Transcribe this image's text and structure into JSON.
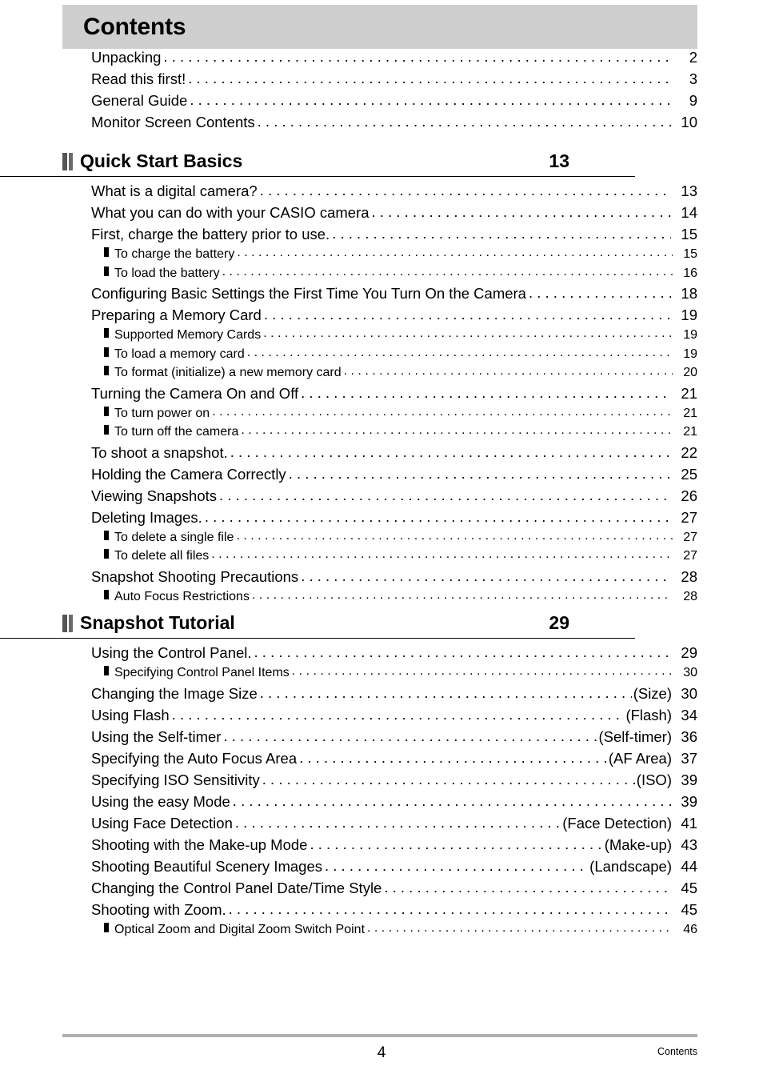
{
  "header": {
    "title": "Contents"
  },
  "footer": {
    "page_number": "4",
    "label": "Contents"
  },
  "icons": {
    "section_marker": "double-bar-icon",
    "sub_entry_marker": "square-bullet-icon"
  },
  "colors": {
    "title_band": "#cfcfcf",
    "section_bar_dark": "#555555",
    "section_bar_light": "#6b6b6b",
    "footer_rule": "#b0b0b0",
    "text": "#000000"
  },
  "intro_entries": [
    {
      "title": "Unpacking",
      "page": "2"
    },
    {
      "title": "Read this first!",
      "page": "3"
    },
    {
      "title": "General Guide",
      "page": "9"
    },
    {
      "title": "Monitor Screen Contents",
      "page": "10"
    }
  ],
  "sections": [
    {
      "title": "Quick Start Basics",
      "page": "13",
      "entries": [
        {
          "level": 1,
          "title": "What is a digital camera?",
          "suffix": "",
          "page": "13"
        },
        {
          "level": 1,
          "title": "What you can do with your CASIO camera",
          "suffix": "",
          "page": "14"
        },
        {
          "level": 1,
          "title": "First, charge the battery prior to use.",
          "suffix": "",
          "page": "15"
        },
        {
          "level": 2,
          "title": "To charge the battery",
          "suffix": "",
          "page": "15"
        },
        {
          "level": 2,
          "title": "To load the battery",
          "suffix": "",
          "page": "16"
        },
        {
          "level": 1,
          "title": "Configuring Basic Settings the First Time You Turn On the Camera",
          "suffix": "",
          "page": "18"
        },
        {
          "level": 1,
          "title": "Preparing a Memory Card",
          "suffix": "",
          "page": "19"
        },
        {
          "level": 2,
          "title": "Supported Memory Cards",
          "suffix": "",
          "page": "19"
        },
        {
          "level": 2,
          "title": "To load a memory card",
          "suffix": "",
          "page": "19"
        },
        {
          "level": 2,
          "title": "To format (initialize) a new memory card",
          "suffix": "",
          "page": "20"
        },
        {
          "level": 1,
          "title": "Turning the Camera On and Off",
          "suffix": "",
          "page": "21"
        },
        {
          "level": 2,
          "title": "To turn power on",
          "suffix": "",
          "page": "21"
        },
        {
          "level": 2,
          "title": "To turn off the camera",
          "suffix": "",
          "page": "21"
        },
        {
          "level": 1,
          "title": "To shoot a snapshot.",
          "suffix": "",
          "page": "22"
        },
        {
          "level": 1,
          "title": "Holding the Camera Correctly",
          "suffix": "",
          "page": "25"
        },
        {
          "level": 1,
          "title": "Viewing Snapshots",
          "suffix": "",
          "page": "26"
        },
        {
          "level": 1,
          "title": "Deleting Images.",
          "suffix": "",
          "page": "27"
        },
        {
          "level": 2,
          "title": "To delete a single file",
          "suffix": "",
          "page": "27"
        },
        {
          "level": 2,
          "title": "To delete all files",
          "suffix": "",
          "page": "27"
        },
        {
          "level": 1,
          "title": "Snapshot Shooting Precautions",
          "suffix": "",
          "page": "28"
        },
        {
          "level": 2,
          "title": "Auto Focus Restrictions",
          "suffix": "",
          "page": "28"
        }
      ]
    },
    {
      "title": "Snapshot Tutorial",
      "page": "29",
      "entries": [
        {
          "level": 1,
          "title": "Using the Control Panel.",
          "suffix": "",
          "page": "29"
        },
        {
          "level": 2,
          "title": "Specifying Control Panel Items",
          "suffix": "",
          "page": "30"
        },
        {
          "level": 1,
          "title": "Changing the Image Size",
          "suffix": "(Size)",
          "page": "30"
        },
        {
          "level": 1,
          "title": "Using Flash",
          "suffix": "(Flash)",
          "page": "34"
        },
        {
          "level": 1,
          "title": "Using the Self-timer",
          "suffix": "(Self-timer)",
          "page": "36"
        },
        {
          "level": 1,
          "title": "Specifying the Auto Focus Area",
          "suffix": "(AF Area)",
          "page": "37"
        },
        {
          "level": 1,
          "title": "Specifying ISO Sensitivity",
          "suffix": "(ISO)",
          "page": "39"
        },
        {
          "level": 1,
          "title": "Using the easy Mode",
          "suffix": "",
          "page": "39"
        },
        {
          "level": 1,
          "title": "Using Face Detection",
          "suffix": "(Face Detection)",
          "page": "41"
        },
        {
          "level": 1,
          "title": "Shooting with the Make-up Mode",
          "suffix": "(Make-up)",
          "page": "43"
        },
        {
          "level": 1,
          "title": "Shooting Beautiful Scenery Images",
          "suffix": "(Landscape)",
          "page": "44"
        },
        {
          "level": 1,
          "title": "Changing the Control Panel Date/Time Style",
          "suffix": "",
          "page": "45"
        },
        {
          "level": 1,
          "title": "Shooting with Zoom.",
          "suffix": "",
          "page": "45"
        },
        {
          "level": 2,
          "title": "Optical Zoom and Digital Zoom Switch Point",
          "suffix": "",
          "page": "46"
        }
      ]
    }
  ]
}
